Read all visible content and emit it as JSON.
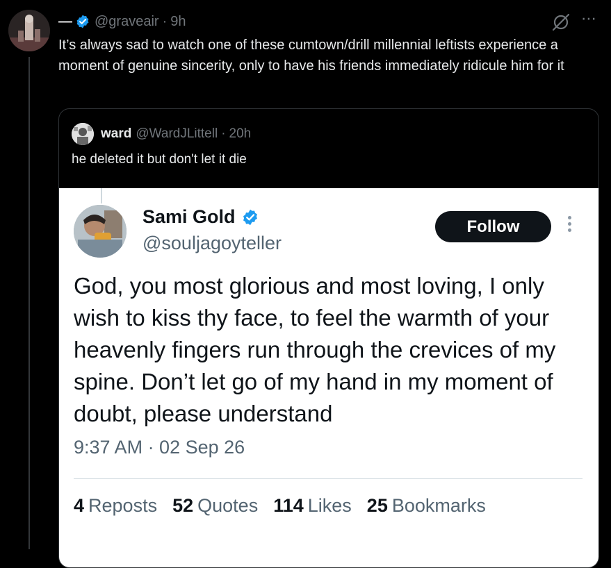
{
  "tweet": {
    "dash": "—",
    "handle": "@graveair",
    "separator": "·",
    "time": "9h",
    "text": "It’s always sad to watch one of these cumtown/drill millennial leftists experience a moment of genuine sincerity, only to have his friends immediately ridicule him for it",
    "more_icon": "⋯",
    "icons": [
      "verified-badge-icon",
      "grok-icon",
      "more-icon"
    ]
  },
  "quote": {
    "name": "ward",
    "handle": "@WardJLittell",
    "separator": "·",
    "time": "20h",
    "text": "he deleted it but don't let it die"
  },
  "screenshot": {
    "name": "Sami Gold",
    "handle": "@souljagoyteller",
    "follow_label": "Follow",
    "body": "God, you most glorious and most loving, I only wish to kiss thy face, to feel the warmth of your heavenly fingers run through the crevices of my spine. Don’t let go of my hand in my moment of doubt, please understand",
    "timestamp": "9:37 AM · 02 Sep 26",
    "stats": [
      {
        "count": "4",
        "label": "Reposts"
      },
      {
        "count": "52",
        "label": "Quotes"
      },
      {
        "count": "114",
        "label": "Likes"
      },
      {
        "count": "25",
        "label": "Bookmarks"
      }
    ]
  },
  "colors": {
    "background": "#000000",
    "text": "#e7e9ea",
    "muted": "#71767b",
    "verified": "#1d9bf0",
    "follow_button": "#0f1419"
  }
}
